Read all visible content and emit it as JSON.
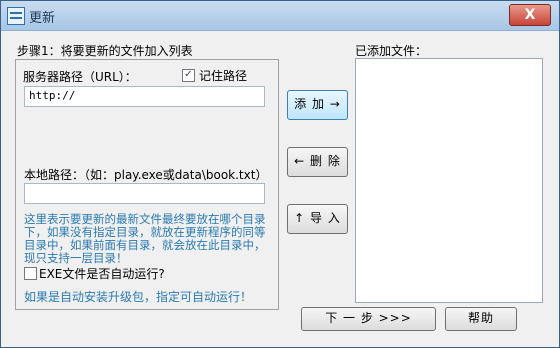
{
  "window": {
    "title": "更新",
    "close_symbol": "X"
  },
  "step_label": "步骤1：将要更新的文件加入列表",
  "server": {
    "label": "服务器路径（URL）：",
    "remember_checked": true,
    "remember_label": "记住路径",
    "url_value": "http://"
  },
  "local": {
    "label": "本地路径：（如：play.exe或data\\book.txt）",
    "value": ""
  },
  "info_text": "这里表示要更新的最新文件最终要放在哪个目录下，如果没有指定目录，就放在更新程序的同等目录中，如果前面有目录，就会放在此目录中，现只支持一层目录！",
  "exe": {
    "checked": false,
    "label": "EXE文件是否自动运行?"
  },
  "auto_hint": "如果是自动安装升级包，指定可自动运行！",
  "buttons": {
    "add": "添 加 →",
    "delete": "← 删 除",
    "import": "↑ 导 入",
    "next": "下 一 步 >>>",
    "help": "帮助"
  },
  "added_files": {
    "label": "已添加文件：",
    "items": []
  },
  "colors": {
    "info_text": "#2a7ab0",
    "titlebar": "#b8d1ec",
    "close_button": "#c8443a"
  }
}
